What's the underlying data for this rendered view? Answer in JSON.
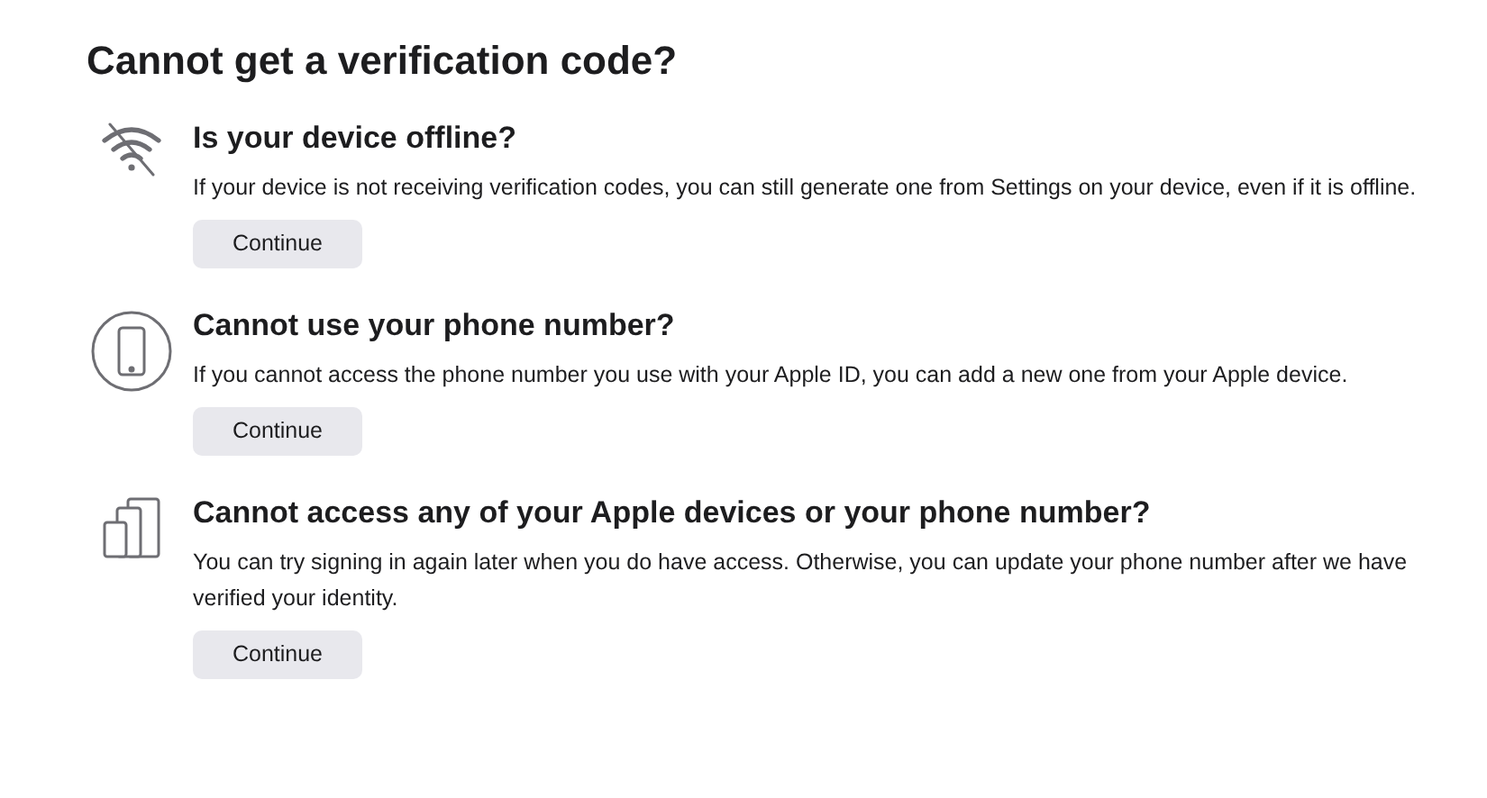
{
  "title": "Cannot get a verification code?",
  "options": [
    {
      "kind": "offline",
      "heading": "Is your device offline?",
      "text": "If your device is not receiving verification codes, you can still generate one from Settings on your device, even if it is offline.",
      "button": "Continue"
    },
    {
      "kind": "phone",
      "heading": "Cannot use your phone number?",
      "text": "If you cannot access the phone number you use with your Apple ID, you can add a new one from your Apple device.",
      "button": "Continue"
    },
    {
      "kind": "devices",
      "heading": "Cannot access any of your Apple devices or your phone number?",
      "text": "You can try signing in again later when you do have access. Otherwise, you can update your phone number after we have verified your identity.",
      "button": "Continue"
    }
  ]
}
